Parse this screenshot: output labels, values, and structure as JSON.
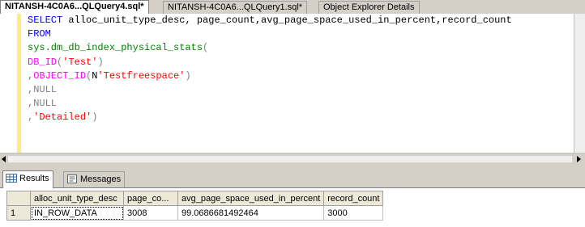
{
  "tabs": [
    {
      "label": "NITANSH-4C0A6...QLQuery4.sql*",
      "active": true
    },
    {
      "label": "NITANSH-4C0A6...QLQuery1.sql*",
      "active": false
    },
    {
      "label": "Object Explorer Details",
      "active": false
    }
  ],
  "editor": {
    "line1": {
      "kw": "SELECT",
      "rest": " alloc_unit_type_desc, page_count,avg_page_space_used_in_percent,record_count"
    },
    "line2": {
      "kw": "FROM"
    },
    "line3": {
      "sys": "sys.dm_db_index_physical_stats",
      "paren": "("
    },
    "line4": {
      "fn": "DB_ID",
      "open": "(",
      "str": "'Test'",
      "close": ")"
    },
    "line5": {
      "comma": ",",
      "fn": "OBJECT_ID",
      "open": "(",
      "n": "N",
      "str": "'Testfreespace'",
      "close": ")"
    },
    "line6": {
      "comma": ",",
      "kw": "NULL"
    },
    "line7": {
      "comma": ",",
      "kw": "NULL"
    },
    "line8": {
      "comma": ",",
      "str": "'Detailed'",
      "close": ")"
    }
  },
  "results_tabs": [
    {
      "label": "Results",
      "icon": "results-grid-icon",
      "active": true
    },
    {
      "label": "Messages",
      "icon": "messages-icon",
      "active": false
    }
  ],
  "grid": {
    "columns": [
      "alloc_unit_type_desc",
      "page_co...",
      "avg_page_space_used_in_percent",
      "record_count"
    ],
    "rows": [
      {
        "num": "1",
        "cells": [
          "IN_ROW_DATA",
          "3008",
          "99.0686681492464",
          "3000"
        ]
      }
    ]
  }
}
